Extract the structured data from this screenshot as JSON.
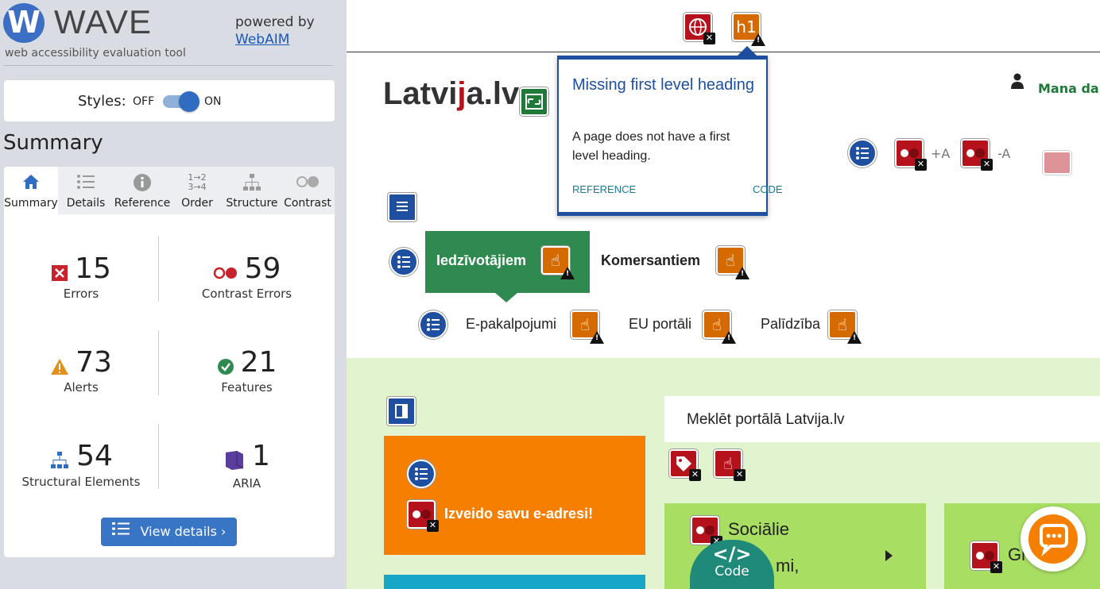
{
  "sidebar": {
    "logo_mark": "W",
    "logo_text": "WAVE",
    "logo_subtitle": "web accessibility evaluation tool",
    "powered_by": "powered by",
    "powered_link": "WebAIM",
    "styles_label": "Styles:",
    "styles_off": "OFF",
    "styles_on": "ON",
    "summary_heading": "Summary",
    "tabs": [
      {
        "label": "Summary",
        "icon": "home-icon",
        "active": true
      },
      {
        "label": "Details",
        "icon": "list-icon"
      },
      {
        "label": "Reference",
        "icon": "info-icon"
      },
      {
        "label": "Order",
        "icon": "order-icon"
      },
      {
        "label": "Structure",
        "icon": "structure-icon"
      },
      {
        "label": "Contrast",
        "icon": "contrast-icon"
      }
    ],
    "stats": {
      "errors": {
        "value": "15",
        "label": "Errors",
        "color": "#c8232c"
      },
      "contrast": {
        "value": "59",
        "label": "Contrast Errors",
        "color": "#c8232c"
      },
      "alerts": {
        "value": "73",
        "label": "Alerts",
        "color": "#e1901a"
      },
      "features": {
        "value": "21",
        "label": "Features",
        "color": "#2f8a4f"
      },
      "structural": {
        "value": "54",
        "label": "Structural Elements",
        "color": "#2f6cc2"
      },
      "aria": {
        "value": "1",
        "label": "ARIA",
        "color": "#5b3d9e"
      }
    },
    "view_details": "View details ›"
  },
  "main": {
    "top_icon_h1": "h1",
    "popup": {
      "title": "Missing first level heading",
      "body": "A page does not have a first level heading.",
      "reference": "REFERENCE",
      "code": "CODE"
    },
    "site_logo_a": "Latvi",
    "site_logo_b": "j",
    "site_logo_c": "a.lv",
    "mana": "Mana dar",
    "plus_a": "+A",
    "minus_a": "-A",
    "nav": {
      "iedzivotajiem": "Iedzīvotājiem",
      "komersantiem": "Komersantiem",
      "epakalpojumi": "E-pakalpojumi",
      "eu": "EU portāli",
      "palidziba": "Palīdzība"
    },
    "orange_link": "Izveido savu e-adresi!",
    "search_text": "Meklēt portālā Latvija.lv",
    "card_text": "Sociālie",
    "card_text2": "mi,",
    "card2_text": "Gi",
    "code_tab_label": "Code",
    "code_tab_glyph": "</>"
  }
}
